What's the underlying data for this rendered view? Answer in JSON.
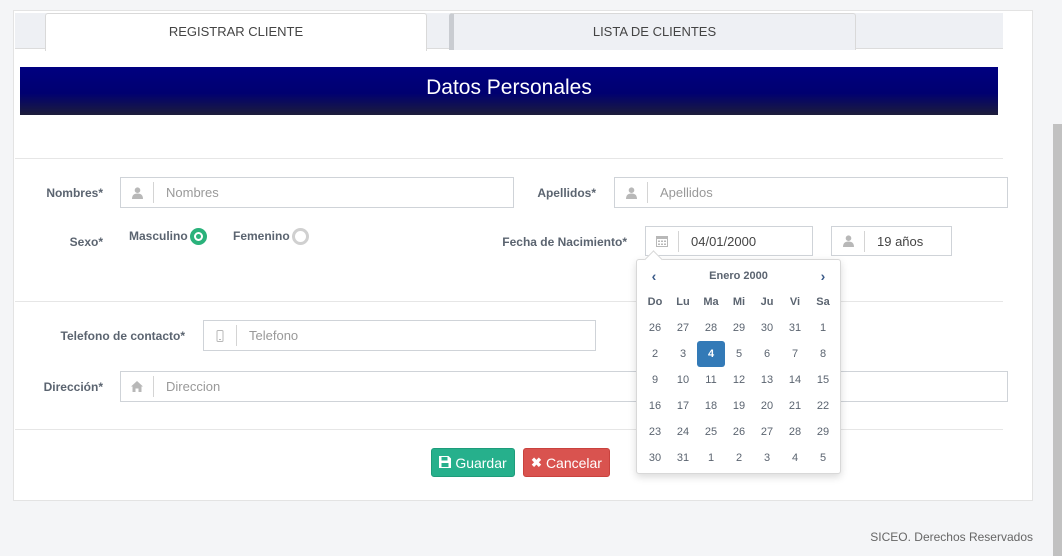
{
  "tabs": [
    {
      "label": "REGISTRAR CLIENTE",
      "active": true
    },
    {
      "label": "LISTA DE CLIENTES",
      "active": false
    }
  ],
  "banner": {
    "title": "Datos Personales"
  },
  "form": {
    "nombres_label": "Nombres*",
    "nombres_placeholder": "Nombres",
    "apellidos_label": "Apellidos*",
    "apellidos_placeholder": "Apellidos",
    "sexo_label": "Sexo*",
    "masculino_label": "Masculino",
    "femenino_label": "Femenino",
    "sexo_selected": "Masculino",
    "fecha_label": "Fecha de Nacimiento*",
    "fecha_value": "04/01/2000",
    "edad_value": "19 años",
    "telefono_label": "Telefono de contacto*",
    "telefono_placeholder": "Telefono",
    "direccion_label": "Dirección*",
    "direccion_placeholder": "Direccion"
  },
  "buttons": {
    "save": "Guardar",
    "cancel": "Cancelar"
  },
  "calendar": {
    "month_label": "Enero 2000",
    "prev": "‹",
    "next": "›",
    "weekdays": [
      "Do",
      "Lu",
      "Ma",
      "Mi",
      "Ju",
      "Vi",
      "Sa"
    ],
    "weeks": [
      [
        "26",
        "27",
        "28",
        "29",
        "30",
        "31",
        "1"
      ],
      [
        "2",
        "3",
        "4",
        "5",
        "6",
        "7",
        "8"
      ],
      [
        "9",
        "10",
        "11",
        "12",
        "13",
        "14",
        "15"
      ],
      [
        "16",
        "17",
        "18",
        "19",
        "20",
        "21",
        "22"
      ],
      [
        "23",
        "24",
        "25",
        "26",
        "27",
        "28",
        "29"
      ],
      [
        "30",
        "31",
        "1",
        "2",
        "3",
        "4",
        "5"
      ]
    ],
    "selected_day": "4"
  },
  "footer": {
    "text": "SICEO. Derechos Reservados"
  },
  "icons": {
    "user": "user-icon",
    "calendar": "calendar-icon",
    "phone": "mobile-icon",
    "home": "home-icon",
    "save": "save-icon",
    "cancel": "times-icon"
  },
  "colors": {
    "banner": "#000080",
    "radio_on": "#2ab27b",
    "save_button": "#26b08c",
    "cancel_button": "#d9534f",
    "selected_day": "#337ab7"
  }
}
